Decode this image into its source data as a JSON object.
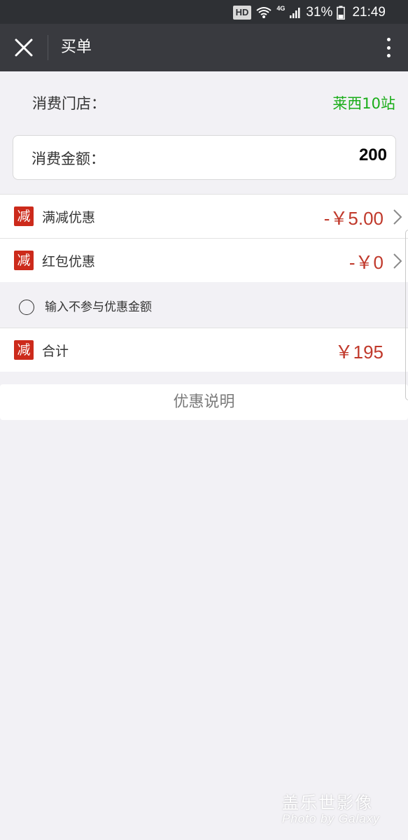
{
  "status_bar": {
    "hd": "HD",
    "network": "4G",
    "battery": "31%",
    "time": "21:49"
  },
  "title_bar": {
    "title": "买单",
    "close_icon": "close-icon",
    "more_icon": "more-vertical-icon"
  },
  "store": {
    "label": "消费门店：",
    "value": "莱西10站"
  },
  "amount": {
    "label": "消费金额：",
    "value": "200"
  },
  "discounts": [
    {
      "badge": "减",
      "label": "满减优惠",
      "value": "-￥5.00"
    },
    {
      "badge": "减",
      "label": "红包优惠",
      "value": "-￥0"
    }
  ],
  "exclude": {
    "label": "输入不参与优惠金额",
    "checked": false
  },
  "total": {
    "badge": "减",
    "label": "合计",
    "value": "￥195"
  },
  "promo_button": "优惠说明",
  "watermark": {
    "main": "盖乐世影像",
    "sub": "Photo by Galaxy"
  },
  "colors": {
    "title_bg": "#393a3f",
    "status_bg": "#2e3034",
    "accent_green": "#1aad19",
    "price_red": "#c0392b",
    "badge_red": "#cc2a1b",
    "page_bg": "#f2f1f5"
  }
}
